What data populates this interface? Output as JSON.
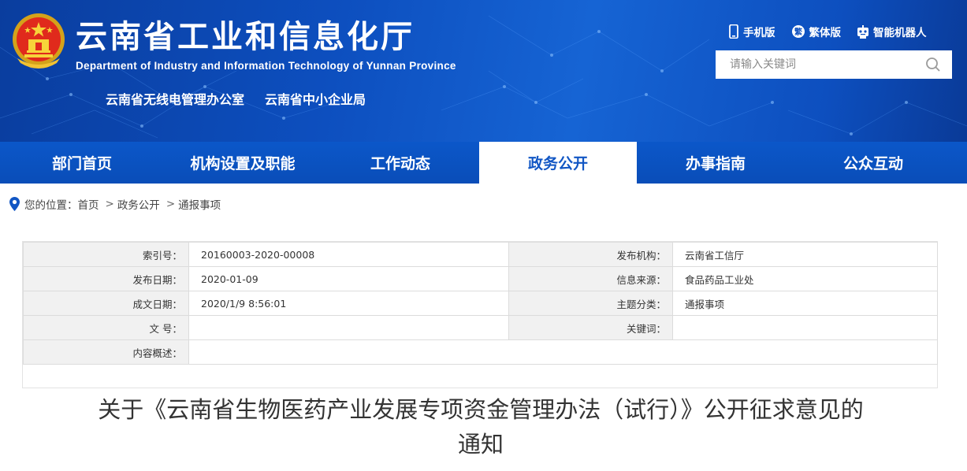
{
  "header": {
    "title": "云南省工业和信息化厅",
    "subtitle": "Department of Industry and Information Technology of Yunnan Province",
    "sub_links": [
      "云南省无线电管理办公室",
      "云南省中小企业局"
    ],
    "tools": [
      {
        "label": "手机版",
        "icon": "mobile-icon"
      },
      {
        "label": "繁体版",
        "icon": "traditional-chinese-icon"
      },
      {
        "label": "智能机器人",
        "icon": "robot-icon"
      }
    ],
    "search_placeholder": "请输入关键词"
  },
  "nav": {
    "items": [
      "部门首页",
      "机构设置及职能",
      "工作动态",
      "政务公开",
      "办事指南",
      "公众互动"
    ],
    "active_index": 3
  },
  "breadcrumb": {
    "prefix": "您的位置：",
    "items": [
      "首页",
      "政务公开",
      "通报事项"
    ],
    "separator": ">"
  },
  "meta": {
    "index_label": "索引号：",
    "index_value": "20160003-2020-00008",
    "publisher_label": "发布机构：",
    "publisher_value": "云南省工信厅",
    "publish_date_label": "发布日期：",
    "publish_date_value": "2020-01-09",
    "source_label": "信息来源：",
    "source_value": "食品药品工业处",
    "created_label": "成文日期：",
    "created_value": "2020/1/9 8:56:01",
    "topic_label": "主题分类：",
    "topic_value": "通报事项",
    "doc_no_label": "文 号：",
    "doc_no_value": "",
    "keywords_label": "关键词：",
    "keywords_value": "",
    "summary_label": "内容概述：",
    "summary_value": ""
  },
  "article": {
    "title_line1": "关于《云南省生物医药产业发展专项资金管理办法（试行）》公开征求意见的",
    "title_line2": "通知"
  },
  "colors": {
    "banner_blue": "#0d4fbf",
    "nav_blue": "#0b57c9",
    "active_text": "#1156c4"
  }
}
